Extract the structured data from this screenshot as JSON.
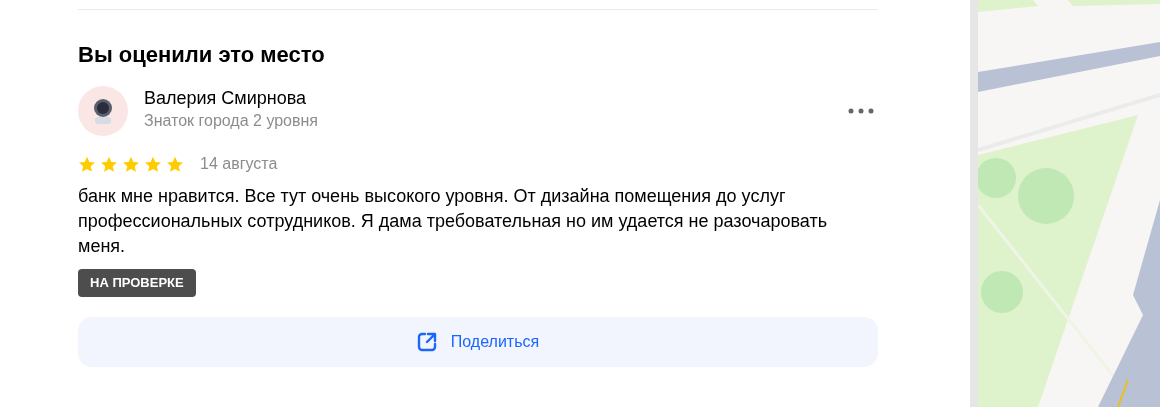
{
  "section_title": "Вы оценили это место",
  "review": {
    "author": "Валерия Смирнова",
    "author_level": "Знаток города 2 уровня",
    "stars": 5,
    "date": "14 августа",
    "text": "банк мне нравится. Все тут очень высокого уровня. От дизайна помещения до услуг профессиональных сотрудников. Я дама требовательная но им удается не разочаровать меня.",
    "status_badge": "НА ПРОВЕРКЕ"
  },
  "share_button": "Поделиться"
}
